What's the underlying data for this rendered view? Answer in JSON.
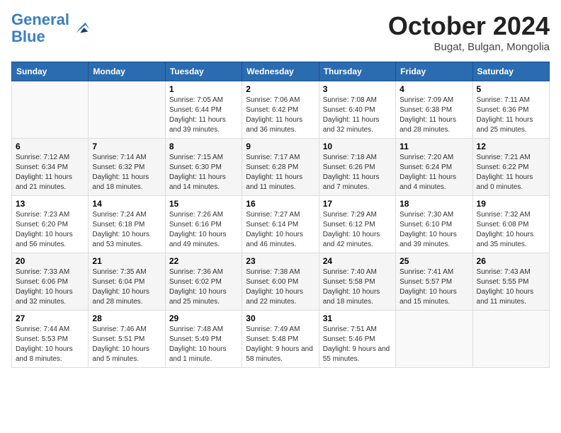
{
  "header": {
    "logo_line1": "General",
    "logo_line2": "Blue",
    "month_title": "October 2024",
    "location": "Bugat, Bulgan, Mongolia"
  },
  "weekdays": [
    "Sunday",
    "Monday",
    "Tuesday",
    "Wednesday",
    "Thursday",
    "Friday",
    "Saturday"
  ],
  "weeks": [
    [
      {
        "day": "",
        "info": ""
      },
      {
        "day": "",
        "info": ""
      },
      {
        "day": "1",
        "info": "Sunrise: 7:05 AM\nSunset: 6:44 PM\nDaylight: 11 hours and 39 minutes."
      },
      {
        "day": "2",
        "info": "Sunrise: 7:06 AM\nSunset: 6:42 PM\nDaylight: 11 hours and 36 minutes."
      },
      {
        "day": "3",
        "info": "Sunrise: 7:08 AM\nSunset: 6:40 PM\nDaylight: 11 hours and 32 minutes."
      },
      {
        "day": "4",
        "info": "Sunrise: 7:09 AM\nSunset: 6:38 PM\nDaylight: 11 hours and 28 minutes."
      },
      {
        "day": "5",
        "info": "Sunrise: 7:11 AM\nSunset: 6:36 PM\nDaylight: 11 hours and 25 minutes."
      }
    ],
    [
      {
        "day": "6",
        "info": "Sunrise: 7:12 AM\nSunset: 6:34 PM\nDaylight: 11 hours and 21 minutes."
      },
      {
        "day": "7",
        "info": "Sunrise: 7:14 AM\nSunset: 6:32 PM\nDaylight: 11 hours and 18 minutes."
      },
      {
        "day": "8",
        "info": "Sunrise: 7:15 AM\nSunset: 6:30 PM\nDaylight: 11 hours and 14 minutes."
      },
      {
        "day": "9",
        "info": "Sunrise: 7:17 AM\nSunset: 6:28 PM\nDaylight: 11 hours and 11 minutes."
      },
      {
        "day": "10",
        "info": "Sunrise: 7:18 AM\nSunset: 6:26 PM\nDaylight: 11 hours and 7 minutes."
      },
      {
        "day": "11",
        "info": "Sunrise: 7:20 AM\nSunset: 6:24 PM\nDaylight: 11 hours and 4 minutes."
      },
      {
        "day": "12",
        "info": "Sunrise: 7:21 AM\nSunset: 6:22 PM\nDaylight: 11 hours and 0 minutes."
      }
    ],
    [
      {
        "day": "13",
        "info": "Sunrise: 7:23 AM\nSunset: 6:20 PM\nDaylight: 10 hours and 56 minutes."
      },
      {
        "day": "14",
        "info": "Sunrise: 7:24 AM\nSunset: 6:18 PM\nDaylight: 10 hours and 53 minutes."
      },
      {
        "day": "15",
        "info": "Sunrise: 7:26 AM\nSunset: 6:16 PM\nDaylight: 10 hours and 49 minutes."
      },
      {
        "day": "16",
        "info": "Sunrise: 7:27 AM\nSunset: 6:14 PM\nDaylight: 10 hours and 46 minutes."
      },
      {
        "day": "17",
        "info": "Sunrise: 7:29 AM\nSunset: 6:12 PM\nDaylight: 10 hours and 42 minutes."
      },
      {
        "day": "18",
        "info": "Sunrise: 7:30 AM\nSunset: 6:10 PM\nDaylight: 10 hours and 39 minutes."
      },
      {
        "day": "19",
        "info": "Sunrise: 7:32 AM\nSunset: 6:08 PM\nDaylight: 10 hours and 35 minutes."
      }
    ],
    [
      {
        "day": "20",
        "info": "Sunrise: 7:33 AM\nSunset: 6:06 PM\nDaylight: 10 hours and 32 minutes."
      },
      {
        "day": "21",
        "info": "Sunrise: 7:35 AM\nSunset: 6:04 PM\nDaylight: 10 hours and 28 minutes."
      },
      {
        "day": "22",
        "info": "Sunrise: 7:36 AM\nSunset: 6:02 PM\nDaylight: 10 hours and 25 minutes."
      },
      {
        "day": "23",
        "info": "Sunrise: 7:38 AM\nSunset: 6:00 PM\nDaylight: 10 hours and 22 minutes."
      },
      {
        "day": "24",
        "info": "Sunrise: 7:40 AM\nSunset: 5:58 PM\nDaylight: 10 hours and 18 minutes."
      },
      {
        "day": "25",
        "info": "Sunrise: 7:41 AM\nSunset: 5:57 PM\nDaylight: 10 hours and 15 minutes."
      },
      {
        "day": "26",
        "info": "Sunrise: 7:43 AM\nSunset: 5:55 PM\nDaylight: 10 hours and 11 minutes."
      }
    ],
    [
      {
        "day": "27",
        "info": "Sunrise: 7:44 AM\nSunset: 5:53 PM\nDaylight: 10 hours and 8 minutes."
      },
      {
        "day": "28",
        "info": "Sunrise: 7:46 AM\nSunset: 5:51 PM\nDaylight: 10 hours and 5 minutes."
      },
      {
        "day": "29",
        "info": "Sunrise: 7:48 AM\nSunset: 5:49 PM\nDaylight: 10 hours and 1 minute."
      },
      {
        "day": "30",
        "info": "Sunrise: 7:49 AM\nSunset: 5:48 PM\nDaylight: 9 hours and 58 minutes."
      },
      {
        "day": "31",
        "info": "Sunrise: 7:51 AM\nSunset: 5:46 PM\nDaylight: 9 hours and 55 minutes."
      },
      {
        "day": "",
        "info": ""
      },
      {
        "day": "",
        "info": ""
      }
    ]
  ]
}
